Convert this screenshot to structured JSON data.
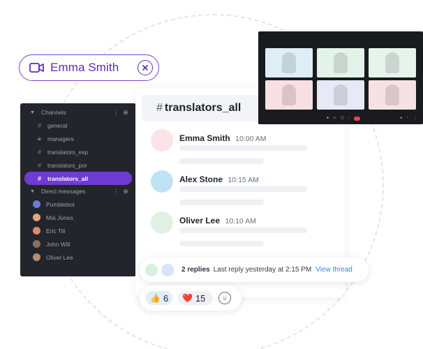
{
  "call": {
    "name": "Emma Smith",
    "icon": "video-camera-icon",
    "close_icon": "close-circle-icon"
  },
  "sidebar": {
    "channels_label": "Channels",
    "channels": [
      {
        "label": "general",
        "icon": "hash-icon",
        "active": false
      },
      {
        "label": "managers",
        "icon": "lock-icon",
        "active": false
      },
      {
        "label": "translators_esp",
        "icon": "hash-icon",
        "active": false
      },
      {
        "label": "translators_por",
        "icon": "hash-icon",
        "active": false
      },
      {
        "label": "translators_all",
        "icon": "hash-icon",
        "active": true
      }
    ],
    "dm_label": "Direct messages",
    "dms": [
      {
        "label": "Pumblebot",
        "color": "#6a7bd8"
      },
      {
        "label": "Mia Jones",
        "color": "#e7a37c"
      },
      {
        "label": "Eric Till",
        "color": "#d98a6e"
      },
      {
        "label": "John Will",
        "color": "#8a6e5e"
      },
      {
        "label": "Oliver Lee",
        "color": "#b98c6a"
      }
    ]
  },
  "chat": {
    "hash": "#",
    "channel": "translators_all",
    "messages": [
      {
        "author": "Emma Smith",
        "time": "10:00 AM",
        "avatar_bg": "#fbe4e7"
      },
      {
        "author": "Alex Stone",
        "time": "10:15 AM",
        "avatar_bg": "#bfe3f5"
      },
      {
        "author": "Oliver Lee",
        "time": "10:10 AM",
        "avatar_bg": "#e1f0e3"
      }
    ]
  },
  "thread": {
    "replies": "2 replies",
    "last_reply": "Last reply yesterday at 2:15 PM",
    "link": "View thread"
  },
  "reactions": [
    {
      "emoji": "👍",
      "count": "6"
    },
    {
      "emoji": "❤️",
      "count": "15"
    }
  ],
  "video": {
    "tiles": [
      {
        "bg": "#dfeef6"
      },
      {
        "bg": "#e3f3ea"
      },
      {
        "bg": "#e6f4ec"
      },
      {
        "bg": "#f7dfe4"
      },
      {
        "bg": "#e7eaf6"
      },
      {
        "bg": "#f6e2e4"
      }
    ]
  }
}
